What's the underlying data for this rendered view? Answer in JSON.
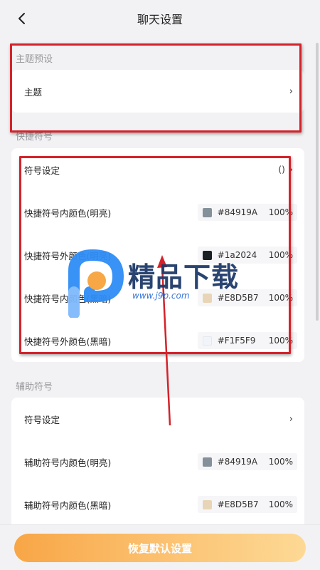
{
  "header": {
    "title": "聊天设置",
    "back_icon": "chevron-left-icon"
  },
  "theme_section": {
    "label": "主题预设",
    "row_label": "主题",
    "chevron": "›"
  },
  "shortcut_section": {
    "label": "快捷符号",
    "symbol_row": {
      "label": "符号设定",
      "value": "()",
      "chevron": "›"
    },
    "color_rows": [
      {
        "label": "快捷符号内颜色(明亮)",
        "hex": "#84919A",
        "swatch": "#84919a",
        "opacity": "100%"
      },
      {
        "label": "快捷符号外颜色(明亮)",
        "hex": "#1a2024",
        "swatch": "#1a2024",
        "opacity": "100%"
      },
      {
        "label": "快捷符号内颜色(黑暗)",
        "hex": "#E8D5B7",
        "swatch": "#e8d5b7",
        "opacity": "100%"
      },
      {
        "label": "快捷符号外颜色(黑暗)",
        "hex": "#F1F5F9",
        "swatch": "#f1f5f9",
        "opacity": "100%"
      }
    ]
  },
  "aux_section": {
    "label": "辅助符号",
    "symbol_row": {
      "label": "符号设定",
      "chevron": "›"
    },
    "color_rows": [
      {
        "label": "辅助符号内颜色(明亮)",
        "hex": "#84919A",
        "swatch": "#84919a",
        "opacity": "100%"
      },
      {
        "label": "辅助符号内颜色(黑暗)",
        "hex": "#E8D5B7",
        "swatch": "#e8d5b7",
        "opacity": "100%"
      }
    ]
  },
  "footer": {
    "restore_label": "恢复默认设置"
  },
  "watermark": {
    "brand": "精品下载",
    "url": "www.j9p.com"
  },
  "colors": {
    "accent_orange": "#f8a646",
    "highlight_red": "#d4222a",
    "background": "#f2f2f4"
  }
}
